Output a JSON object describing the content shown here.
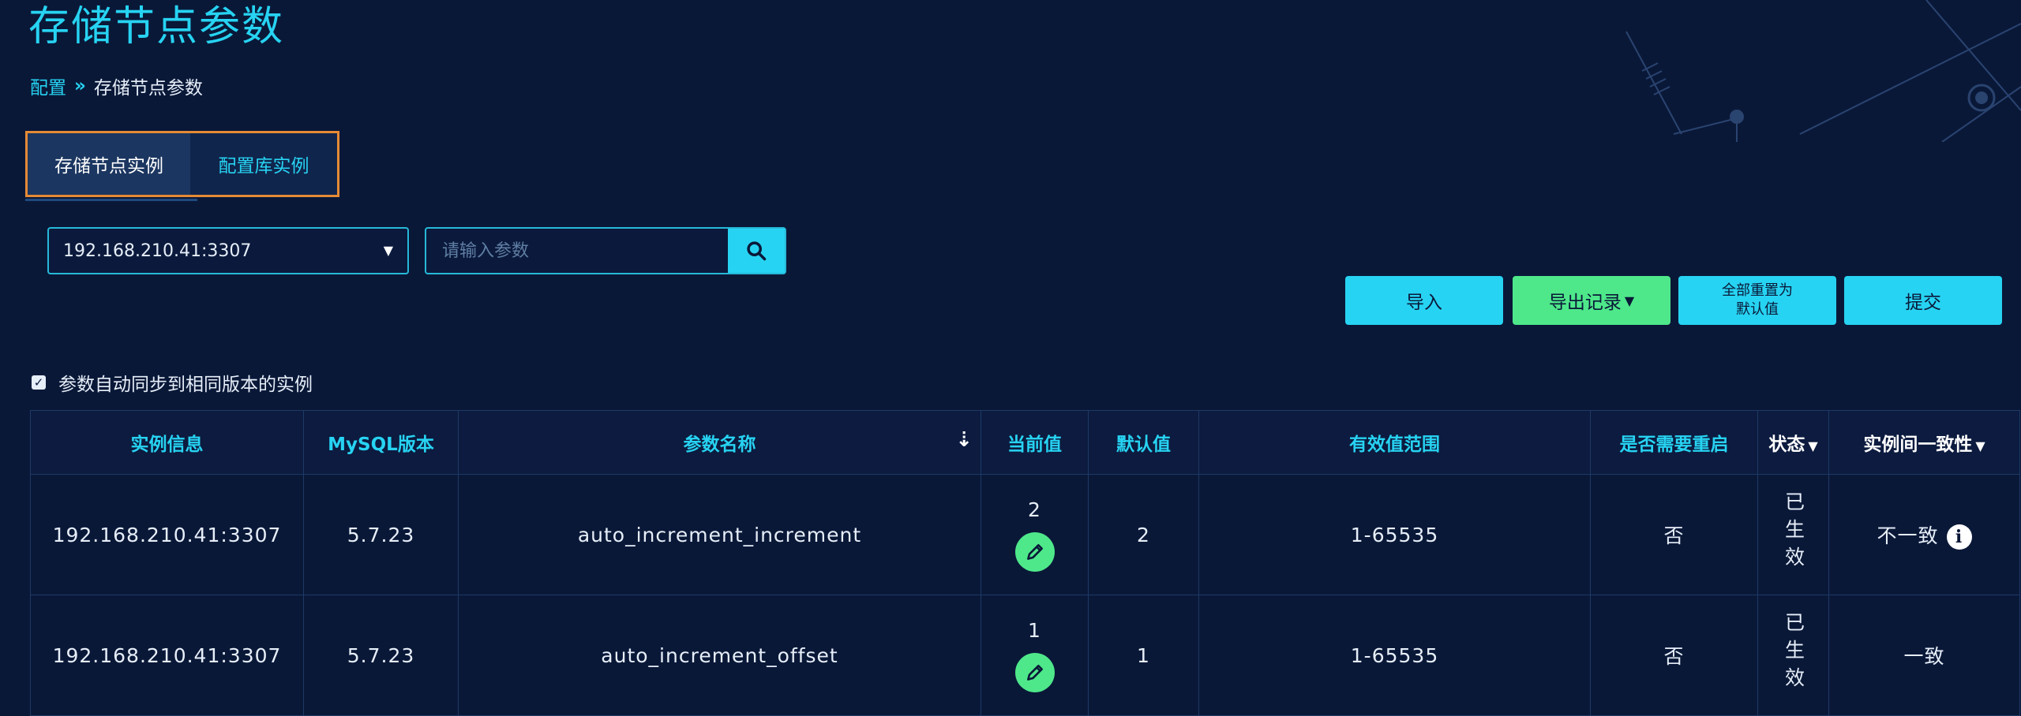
{
  "page": {
    "title": "存储节点参数"
  },
  "breadcrumb": {
    "parent": "配置",
    "separator": "»",
    "current": "存储节点参数"
  },
  "tabs": [
    {
      "label": "存储节点实例",
      "active": true
    },
    {
      "label": "配置库实例",
      "active": false
    }
  ],
  "instance_select": {
    "value": "192.168.210.41:3307"
  },
  "search": {
    "placeholder": "请输入参数"
  },
  "toolbar": {
    "import_label": "导入",
    "export_label": "导出记录",
    "reset_label_line1": "全部重置为",
    "reset_label_line2": "默认值",
    "submit_label": "提交"
  },
  "sync_option": {
    "label": "参数自动同步到相同版本的实例",
    "checked": true
  },
  "table": {
    "headers": [
      "实例信息",
      "MySQL版本",
      "参数名称",
      "当前值",
      "默认值",
      "有效值范围",
      "是否需要重启",
      "状态",
      "实例间一致性"
    ],
    "rows": [
      {
        "instance": "192.168.210.41:3307",
        "version": "5.7.23",
        "param": "auto_increment_increment",
        "current": "2",
        "default": "2",
        "range": "1-65535",
        "restart": "否",
        "status": "已生效",
        "consistency": "不一致"
      },
      {
        "instance": "192.168.210.41:3307",
        "version": "5.7.23",
        "param": "auto_increment_offset",
        "current": "1",
        "default": "1",
        "range": "1-65535",
        "restart": "否",
        "status": "已生效",
        "consistency": "一致"
      }
    ]
  },
  "colors": {
    "accent": "#27d3f2",
    "green": "#4ee88a",
    "tab_border": "#e58a35",
    "background": "#0a1838"
  },
  "icons": [
    "chevron-double-right-icon",
    "caret-down-icon",
    "search-icon",
    "sort-icon",
    "pencil-icon",
    "info-icon",
    "check-icon"
  ]
}
